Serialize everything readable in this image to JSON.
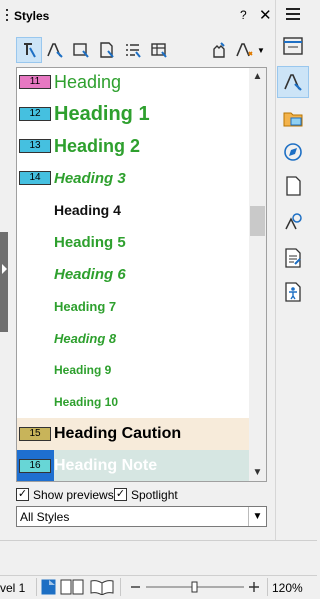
{
  "panel": {
    "title": "Styles",
    "help_label": "?",
    "close_label": "✕"
  },
  "toolbar": {
    "buttons": [
      {
        "name": "paragraph-styles",
        "active": true
      },
      {
        "name": "character-styles"
      },
      {
        "name": "frame-styles"
      },
      {
        "name": "page-styles"
      },
      {
        "name": "list-styles"
      },
      {
        "name": "table-styles"
      },
      {
        "name": "fill-format-mode"
      },
      {
        "name": "new-style-from-selection"
      }
    ]
  },
  "styles": {
    "items": [
      {
        "label": "Heading",
        "badge": "11",
        "badge_color": "#e778c2",
        "color": "#2ea02e",
        "size": 18,
        "bold": false,
        "italic": false
      },
      {
        "label": "Heading 1",
        "badge": "12",
        "badge_color": "#45c0e0",
        "color": "#2ea02e",
        "size": 20,
        "bold": true,
        "italic": false
      },
      {
        "label": "Heading 2",
        "badge": "13",
        "badge_color": "#45c0e0",
        "color": "#2ea02e",
        "size": 18,
        "bold": true,
        "italic": false
      },
      {
        "label": "Heading 3",
        "badge": "14",
        "badge_color": "#45c0e0",
        "color": "#2ea02e",
        "size": 15,
        "bold": true,
        "italic": true
      },
      {
        "label": "Heading 4",
        "badge": "",
        "badge_color": "",
        "color": "#111111",
        "size": 14,
        "bold": true,
        "italic": false
      },
      {
        "label": "Heading 5",
        "badge": "",
        "badge_color": "",
        "color": "#2ea02e",
        "size": 15,
        "bold": true,
        "italic": false
      },
      {
        "label": "Heading 6",
        "badge": "",
        "badge_color": "",
        "color": "#2ea02e",
        "size": 15,
        "bold": true,
        "italic": true
      },
      {
        "label": "Heading 7",
        "badge": "",
        "badge_color": "",
        "color": "#2ea02e",
        "size": 13,
        "bold": true,
        "italic": false
      },
      {
        "label": "Heading 8",
        "badge": "",
        "badge_color": "",
        "color": "#2ea02e",
        "size": 13,
        "bold": true,
        "italic": true
      },
      {
        "label": "Heading 9",
        "badge": "",
        "badge_color": "",
        "color": "#2ea02e",
        "size": 12,
        "bold": true,
        "italic": false
      },
      {
        "label": "Heading 10",
        "badge": "",
        "badge_color": "",
        "color": "#2ea02e",
        "size": 12,
        "bold": true,
        "italic": false
      },
      {
        "label": "Heading Caution",
        "badge": "15",
        "badge_color": "#c8b45a",
        "color": "#000000",
        "size": 16,
        "bold": true,
        "italic": false,
        "bg": "#f7ebda"
      },
      {
        "label": "Heading Note",
        "badge": "16",
        "badge_color": "#67d6d6",
        "color": "#ffffff",
        "size": 16,
        "bold": true,
        "italic": false,
        "bg": "#d6e6e2",
        "selected": true
      }
    ]
  },
  "options": {
    "show_previews": {
      "label": "Show previews",
      "checked": true
    },
    "spotlight": {
      "label": "Spotlight",
      "checked": true
    }
  },
  "filter": {
    "value": "All Styles"
  },
  "deck": {
    "items": [
      "properties",
      "styles",
      "gallery",
      "navigator",
      "page",
      "style-inspector",
      "manage-changes",
      "accessibility-check"
    ],
    "active": "styles"
  },
  "statusbar": {
    "level": "vel 1",
    "zoom": "120%"
  },
  "colors": {
    "accent": "#cce4f7",
    "heading_green": "#2ea02e",
    "selection": "#1e6fd0"
  }
}
